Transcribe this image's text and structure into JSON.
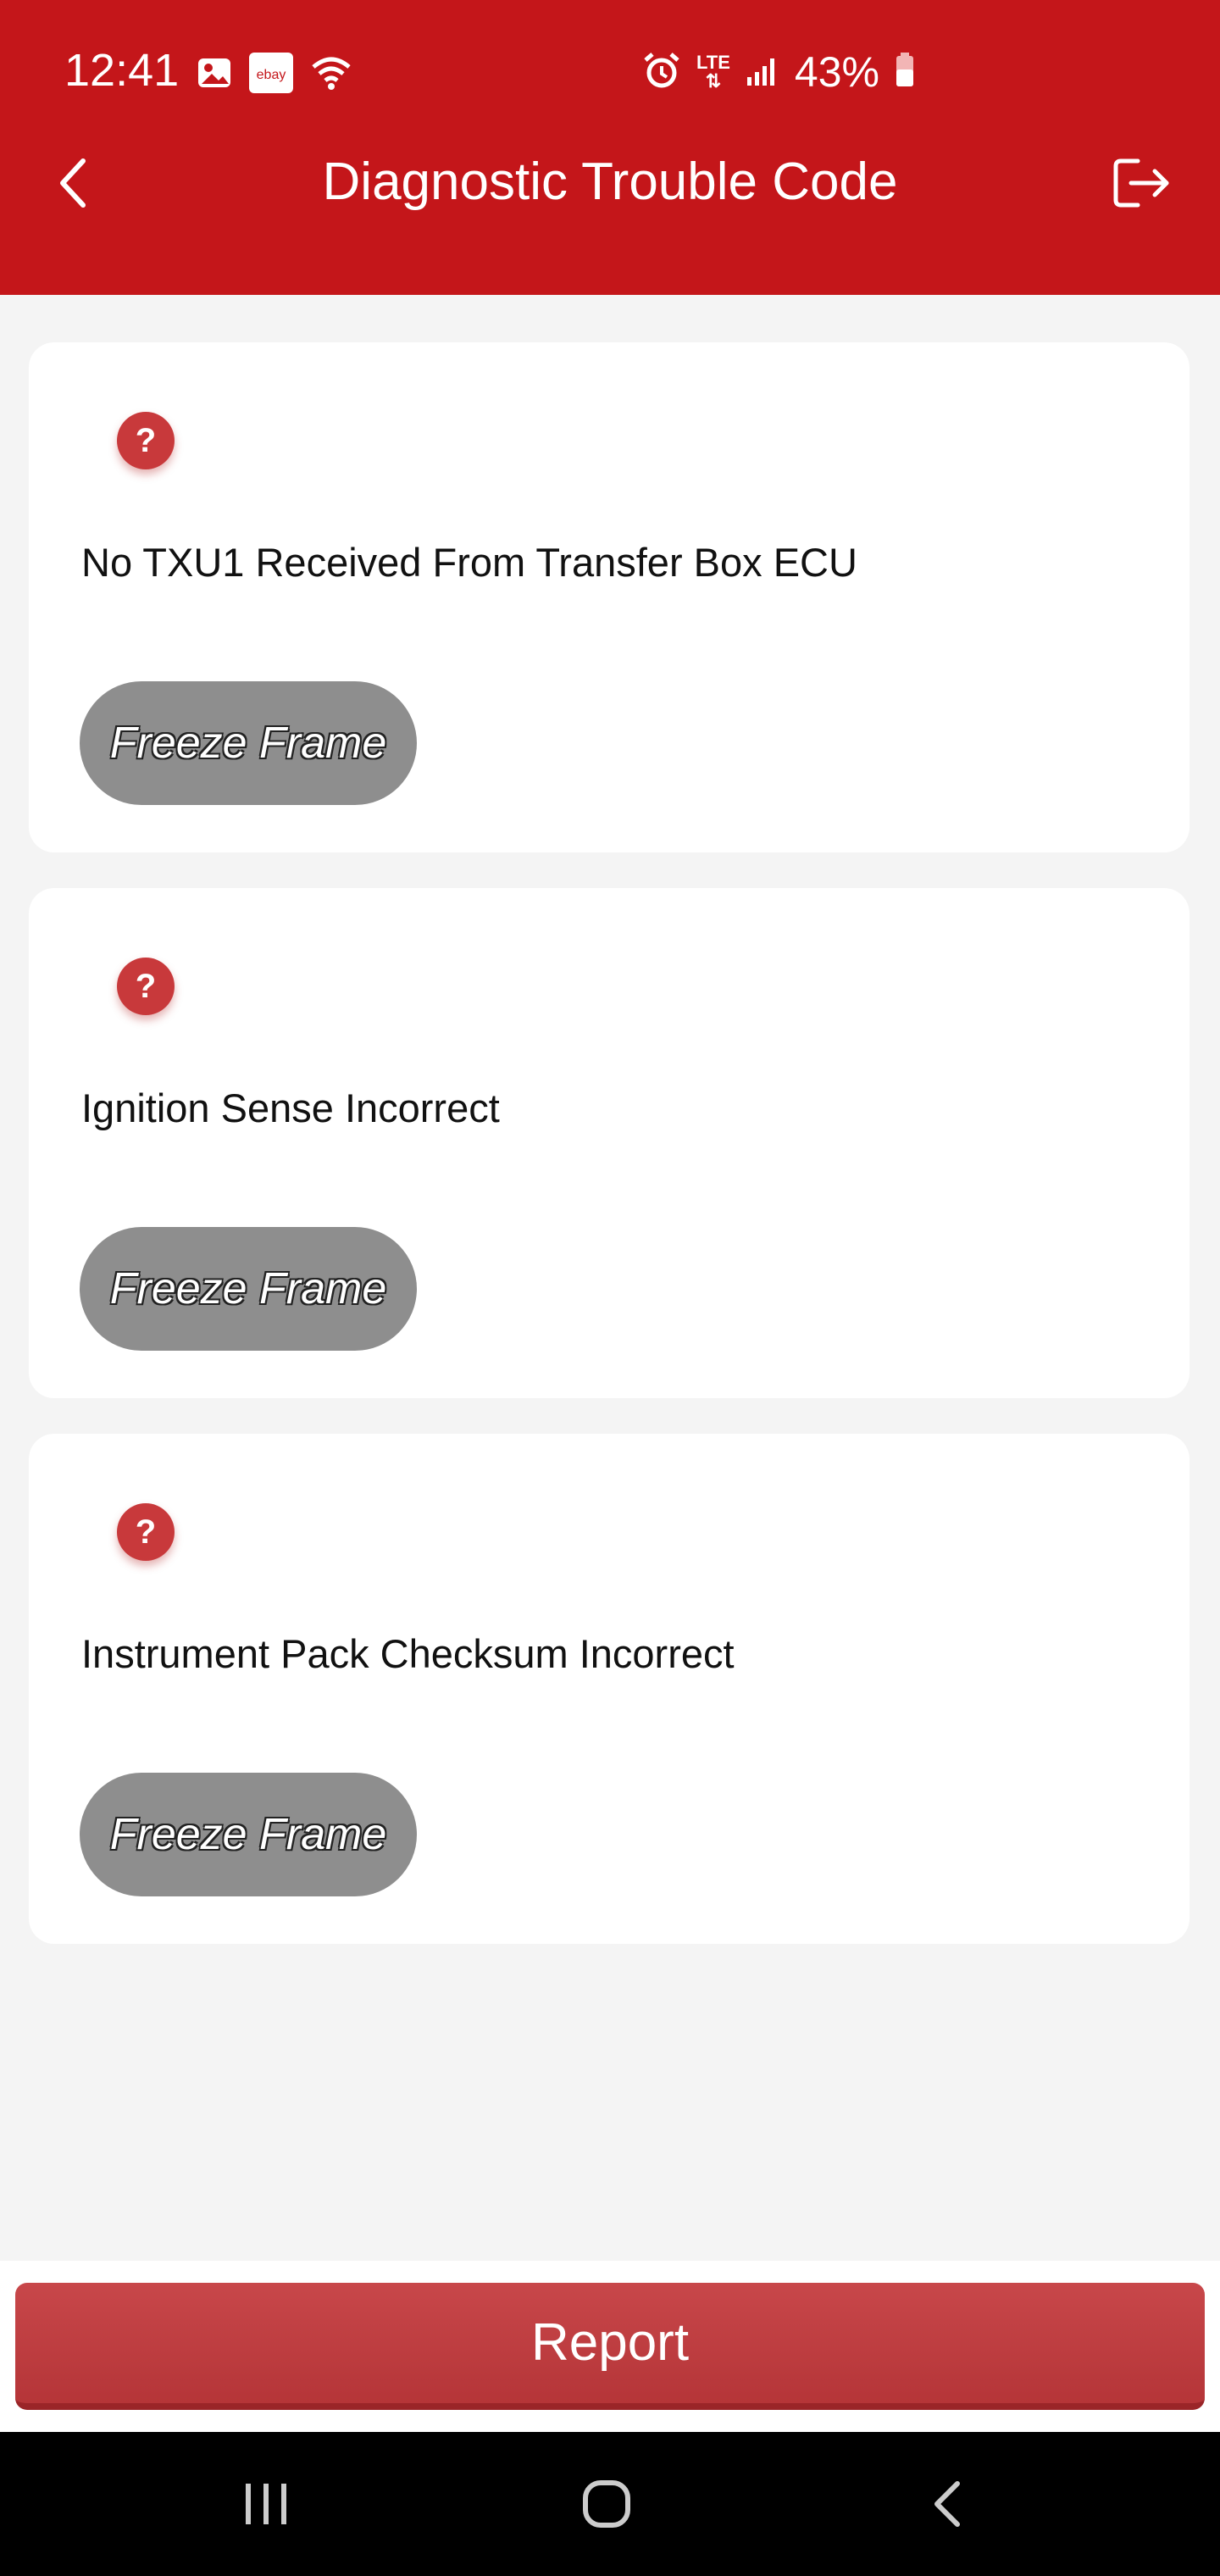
{
  "status_bar": {
    "time": "12:41",
    "battery": "43%",
    "network": "LTE",
    "icons": [
      "gallery-icon",
      "ebay-icon",
      "wifi-icon",
      "alarm-icon",
      "lte-icon",
      "signal-icon",
      "battery-icon"
    ],
    "ebay_label": "ebay"
  },
  "header": {
    "title": "Diagnostic Trouble Code",
    "background_color": "#c4161a"
  },
  "dtcs": [
    {
      "description": "No TXU1 Received From Transfer Box ECU",
      "button_label": "Freeze Frame",
      "help_icon": "?"
    },
    {
      "description": "Ignition Sense Incorrect",
      "button_label": "Freeze Frame",
      "help_icon": "?"
    },
    {
      "description": "Instrument Pack Checksum Incorrect",
      "button_label": "Freeze Frame",
      "help_icon": "?"
    }
  ],
  "footer": {
    "report_label": "Report"
  },
  "colors": {
    "accent": "#c4161a",
    "button_gray": "#8e8e8e",
    "report_button": "#c0393c"
  }
}
